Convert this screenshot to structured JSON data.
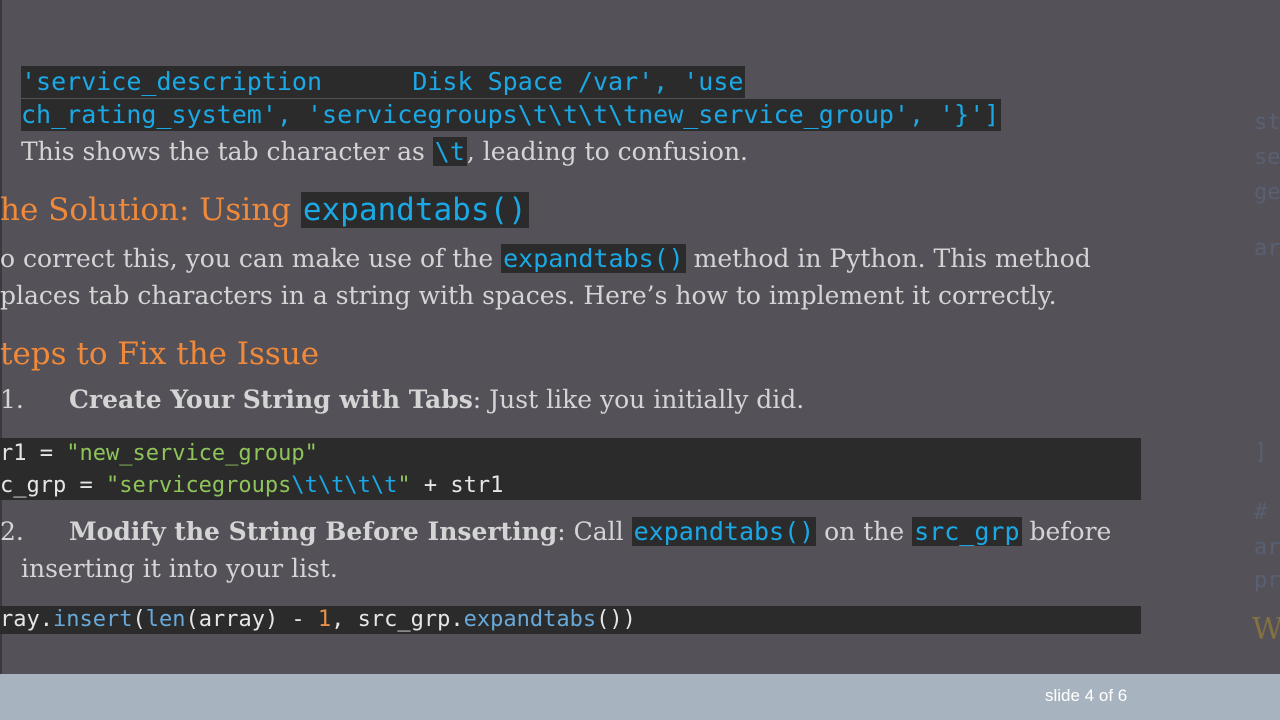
{
  "code_top": {
    "line1": "'service_description      Disk Space /var', 'use",
    "line2": "ch_rating_system', 'servicegroups\\t\\t\\t\\tnew_service_group', '}']"
  },
  "para1": {
    "before": "This shows the tab character as ",
    "code": "\\t",
    "after": ", leading to confusion."
  },
  "heading1": {
    "text": "he Solution: Using ",
    "code": "expandtabs()"
  },
  "para2": {
    "l1_before": "o correct this, you can make use of the ",
    "l1_code": "expandtabs()",
    "l1_after": " method in Python. This method",
    "l2": "places tab characters in a string with spaces. Here’s how to implement it correctly."
  },
  "heading2": {
    "text": "teps to Fix the Issue"
  },
  "step1": {
    "num": "1.",
    "bold": "Create Your String with Tabs",
    "rest": ": Just like you initially did."
  },
  "code_block1": {
    "r1_a": "r1 = ",
    "r1_str": "\"new_service_group\"",
    "r2_a": "c_grp = ",
    "r2_str1": "\"servicegroups",
    "r2_esc": "\\t\\t\\t\\t",
    "r2_str2": "\"",
    "r2_b": " + str1"
  },
  "step2": {
    "num": "2.",
    "bold": "Modify the String Before Inserting",
    "mid1": ": Call ",
    "code1": "expandtabs()",
    "mid2": " on the ",
    "code2": "src_grp",
    "end": " before",
    "line2": "inserting it into your list."
  },
  "code_block2": {
    "a": "ray.",
    "fn1": "insert",
    "b": "(",
    "fn2": "len",
    "c": "(array) - ",
    "num": "1",
    "d": ", src_grp.",
    "fn3": "expandtabs",
    "e": "())"
  },
  "footer": {
    "slide_label": "slide 4 of 6"
  },
  "ghost": {
    "g1": "st",
    "g2": "se",
    "g3": "ge",
    "g4": "ar",
    "g5": "]",
    "g6": "#",
    "g7": "ar",
    "g8": "pr",
    "g9": "W"
  },
  "colors": {
    "background": "#545159",
    "heading": "#f0893a",
    "code_text": "#1aa9e6",
    "code_bg": "#2b2b2b",
    "footer": "#a7b4c0"
  }
}
